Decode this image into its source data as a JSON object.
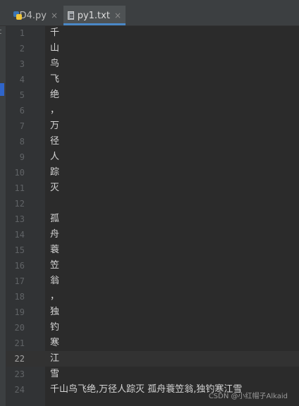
{
  "tabs": [
    {
      "label": "D4.py",
      "close": "×",
      "active": false
    },
    {
      "label": "py1.txt",
      "close": "×",
      "active": true
    }
  ],
  "left_strip_text": "t",
  "current_line": 22,
  "lines": [
    {
      "num": "1",
      "text": "千"
    },
    {
      "num": "2",
      "text": "山"
    },
    {
      "num": "3",
      "text": "鸟"
    },
    {
      "num": "4",
      "text": "飞"
    },
    {
      "num": "5",
      "text": "绝"
    },
    {
      "num": "6",
      "text": "，"
    },
    {
      "num": "7",
      "text": "万"
    },
    {
      "num": "8",
      "text": "径"
    },
    {
      "num": "9",
      "text": "人"
    },
    {
      "num": "10",
      "text": "踪"
    },
    {
      "num": "11",
      "text": "灭"
    },
    {
      "num": "12",
      "text": ""
    },
    {
      "num": "13",
      "text": "孤"
    },
    {
      "num": "14",
      "text": "舟"
    },
    {
      "num": "15",
      "text": "蓑"
    },
    {
      "num": "16",
      "text": "笠"
    },
    {
      "num": "17",
      "text": "翁"
    },
    {
      "num": "18",
      "text": "，"
    },
    {
      "num": "19",
      "text": "独"
    },
    {
      "num": "20",
      "text": "钓"
    },
    {
      "num": "21",
      "text": "寒"
    },
    {
      "num": "22",
      "text": "江"
    },
    {
      "num": "23",
      "text": "雪"
    },
    {
      "num": "24",
      "text": "千山鸟飞绝,万径人踪灭 孤舟蓑笠翁,独钓寒江雪"
    }
  ],
  "watermark": "CSDN @小红帽子Alkaid",
  "colors": {
    "background": "#2b2b2b",
    "accent": "#4a88c7"
  }
}
